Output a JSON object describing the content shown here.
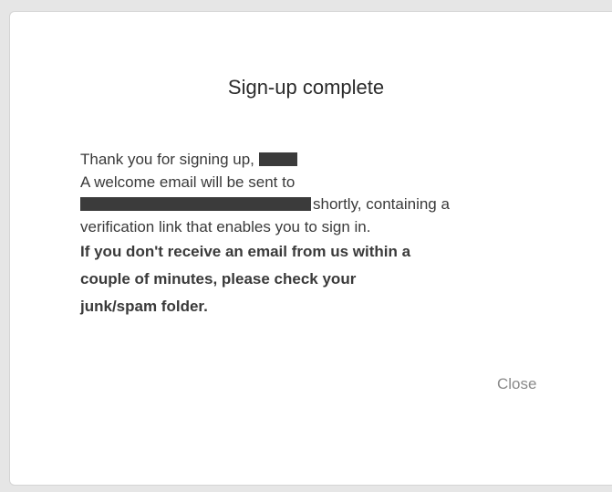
{
  "dialog": {
    "title": "Sign-up complete",
    "line1_prefix": "Thank you for signing up,",
    "line2": "A welcome email will be sent to",
    "line3_suffix": "shortly, containing a",
    "line4": "verification link that enables you to sign in.",
    "bold_line1": "If you don't receive an email from us within a",
    "bold_line2": "couple of minutes, please check your",
    "bold_line3": "junk/spam folder.",
    "close_label": "Close"
  },
  "colors": {
    "backdrop": "#e6e6e6",
    "modal": "#ffffff",
    "text": "#3a3a3a",
    "muted": "#8a8a8a",
    "redaction": "#3b3b3b"
  }
}
